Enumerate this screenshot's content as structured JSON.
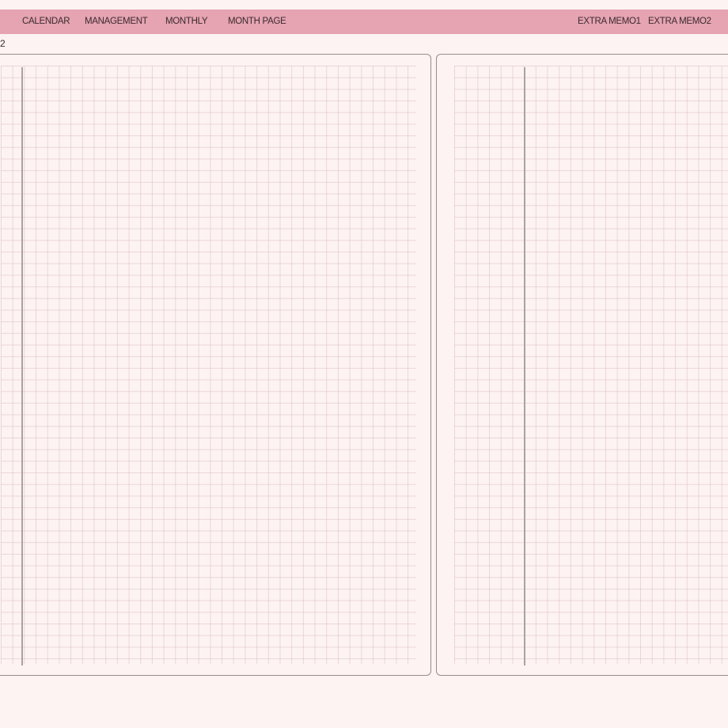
{
  "nav": {
    "left_items": [
      {
        "label": "CALENDAR"
      },
      {
        "label": "MANAGEMENT"
      },
      {
        "label": "MONTHLY"
      },
      {
        "label": "MONTH PAGE"
      }
    ],
    "right_items": [
      {
        "label": "EXTRA MEMO1"
      },
      {
        "label": "EXTRA MEMO2"
      }
    ]
  },
  "page_number": "2",
  "colors": {
    "nav_background": "#e6a3b1",
    "page_background": "#fdf3f3",
    "panel_border": "#9a8c84",
    "grid_line": "#dcbec0",
    "margin_line": "#a9a3a0",
    "text": "#3a2b2e"
  }
}
